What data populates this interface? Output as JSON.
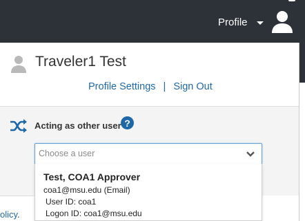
{
  "header": {
    "profile_label": "Profile"
  },
  "panel": {
    "user_name": "Traveler1 Test",
    "profile_settings_label": "Profile Settings",
    "separator": "|",
    "sign_out_label": "Sign Out",
    "acting_label": "Acting as other user",
    "help_glyph": "?",
    "select_placeholder": "Choose a user"
  },
  "results": [
    {
      "name": "Test, COA1 Approver",
      "email": "coa1@msu.edu (Email)",
      "user_id": "User ID: coa1",
      "logon_id": "Logon ID: coa1@msu.edu"
    }
  ],
  "page": {
    "policy_fragment": "olicy",
    "policy_dot": "."
  },
  "icons": {
    "avatar": "user-avatar-icon",
    "shuffle": "shuffle-icon",
    "help": "help-icon",
    "chevron": "chevron-down-icon"
  },
  "colors": {
    "topbar": "#2d3239",
    "link": "#1f68a8",
    "panel_gray": "#f4f4f4"
  }
}
